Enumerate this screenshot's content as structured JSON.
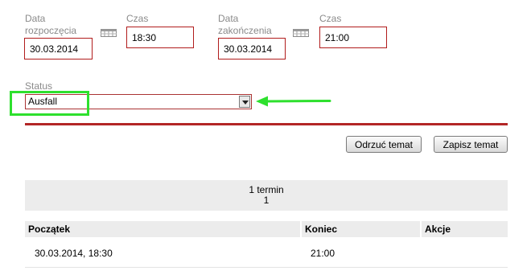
{
  "form": {
    "start_date": {
      "label": "Data rozpoczęcia",
      "value": "30.03.2014"
    },
    "start_time": {
      "label": "Czas",
      "value": "18:30"
    },
    "end_date": {
      "label": "Data zakończenia",
      "value": "30.03.2014"
    },
    "end_time": {
      "label": "Czas",
      "value": "21:00"
    },
    "status": {
      "label": "Status",
      "value": "Ausfall"
    }
  },
  "buttons": {
    "reject": "Odrzuć temat",
    "save": "Zapisz temat"
  },
  "summary": {
    "line1": "1 termin",
    "line2": "1"
  },
  "table": {
    "headers": [
      "Początek",
      "Koniec",
      "Akcje"
    ],
    "rows": [
      [
        "30.03.2014, 18:30",
        "21:00",
        ""
      ]
    ]
  },
  "colors": {
    "field_border": "#b11c1c",
    "divider": "#b32626",
    "highlight": "#2ee02e",
    "panel_bg": "#ececec"
  },
  "icons": [
    "calendar-icon",
    "arrow-icon",
    "chevron-down-icon"
  ]
}
